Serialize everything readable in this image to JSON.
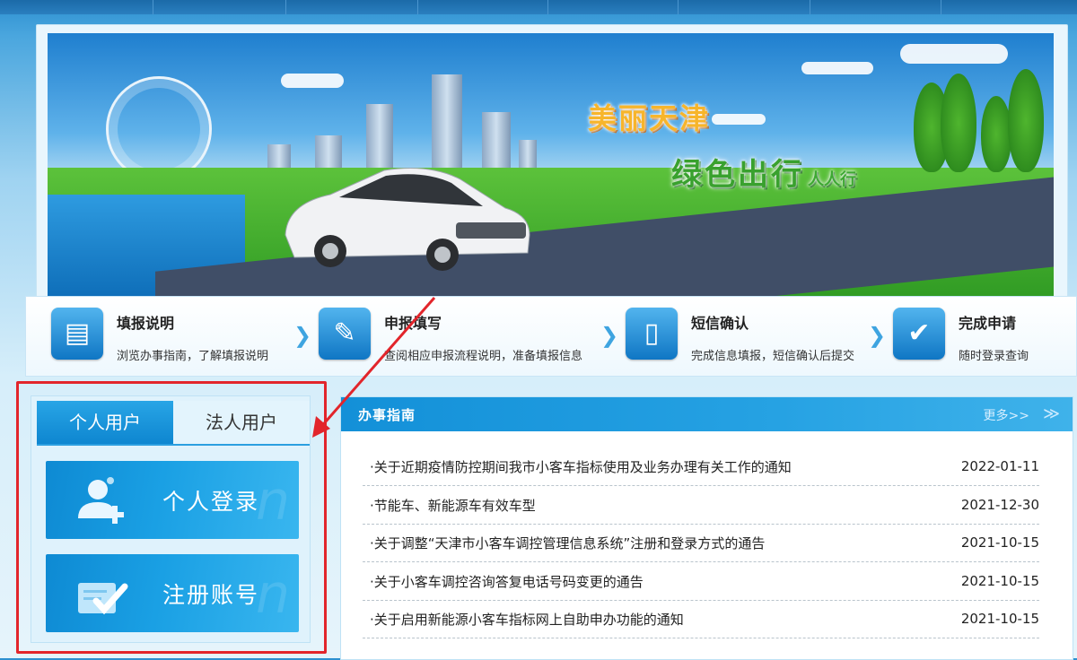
{
  "banner": {
    "slogan_line1": "美丽天津",
    "slogan_line2": "绿色出行",
    "slogan_suffix": "人人行"
  },
  "steps": [
    {
      "title": "填报说明",
      "desc": "浏览办事指南，了解填报说明",
      "icon": "document-icon"
    },
    {
      "title": "申报填写",
      "desc": "查阅相应申报流程说明，准备填报信息",
      "icon": "edit-form-icon"
    },
    {
      "title": "短信确认",
      "desc": "完成信息填报，短信确认后提交",
      "icon": "phone-icon"
    },
    {
      "title": "完成申请",
      "desc": "随时登录查询",
      "icon": "checkmark-icon"
    }
  ],
  "login": {
    "tabs": [
      "个人用户",
      "法人用户"
    ],
    "personal_login": "个人登录",
    "register": "注册账号"
  },
  "news": {
    "title": "办事指南",
    "more": "更多>>",
    "items": [
      {
        "text": "·关于近期疫情防控期间我市小客车指标使用及业务办理有关工作的通知",
        "date": "2022-01-11"
      },
      {
        "text": "·节能车、新能源车有效车型",
        "date": "2021-12-30"
      },
      {
        "text": "·关于调整“天津市小客车调控管理信息系统”注册和登录方式的通告",
        "date": "2021-10-15"
      },
      {
        "text": "·关于小客车调控咨询答复电话号码变更的通告",
        "date": "2021-10-15"
      },
      {
        "text": "·关于启用新能源小客车指标网上自助申办功能的通知",
        "date": "2021-10-15"
      }
    ]
  },
  "colors": {
    "accent": "#1796dc",
    "highlight": "#e2252b",
    "tab_active": "#1a97dd"
  }
}
